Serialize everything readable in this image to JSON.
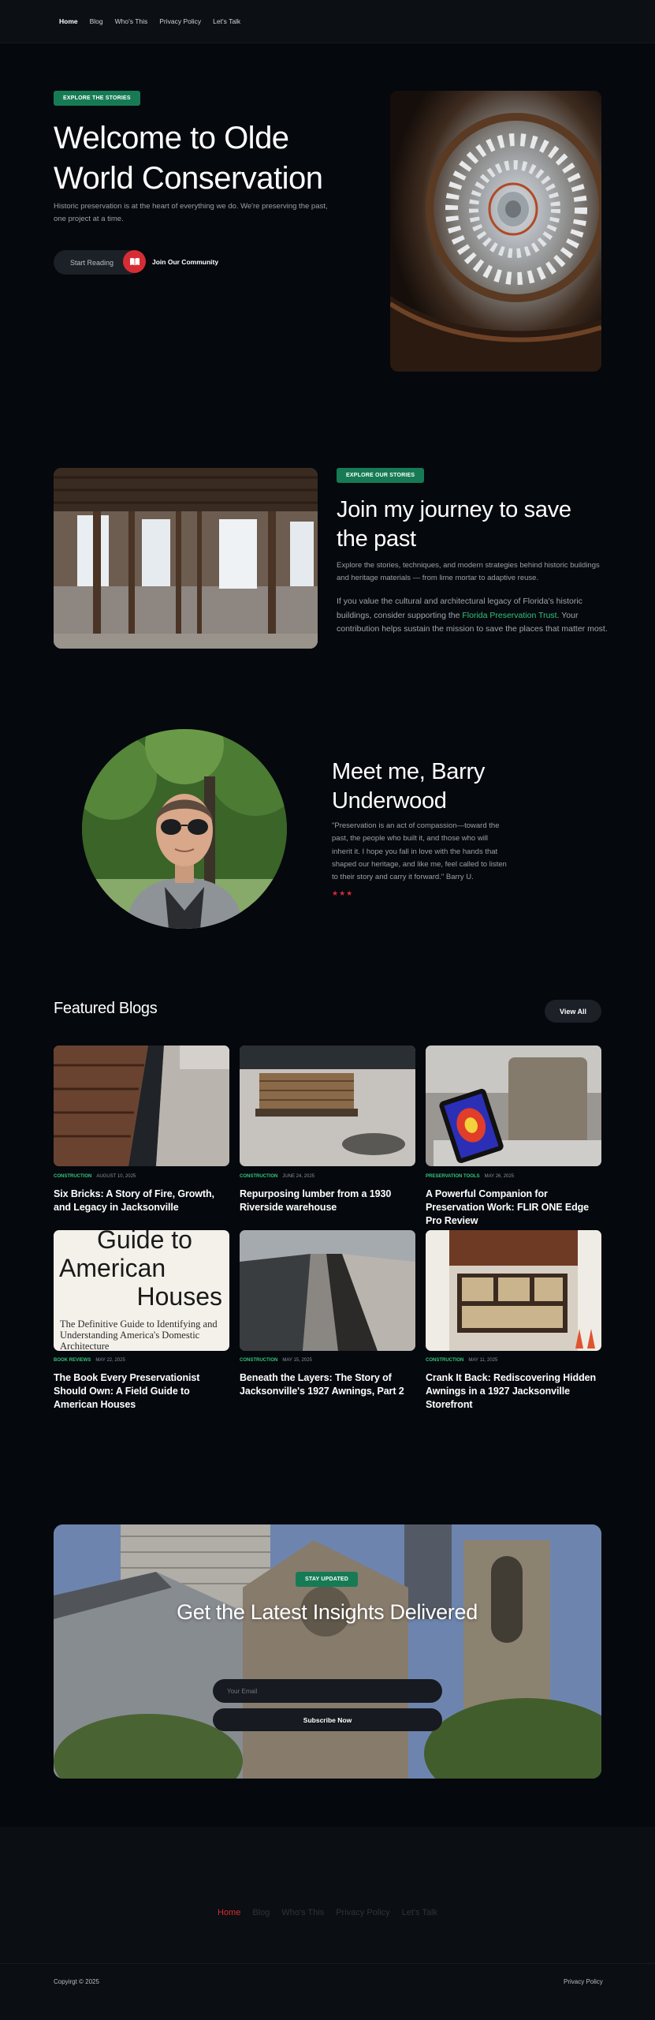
{
  "nav": {
    "items": [
      {
        "label": "Home",
        "active": true
      },
      {
        "label": "Blog"
      },
      {
        "label": "Who's This"
      },
      {
        "label": "Privacy Policy"
      },
      {
        "label": "Let's Talk"
      }
    ]
  },
  "hero": {
    "badge": "EXPLORE THE STORIES",
    "title": "Welcome to Olde World Conservation",
    "subtitle": "Historic preservation is at the heart of everything we do. We're preserving the past, one project at a time.",
    "start_reading": "Start Reading",
    "community_label": "Join Our Community",
    "icon": "book-icon"
  },
  "join": {
    "badge": "EXPLORE OUR STORIES",
    "title": "Join my journey to save the past",
    "intro": "Explore the stories, techniques, and modern strategies behind historic buildings and heritage materials — from lime mortar to adaptive reuse.",
    "body_before": "If you value the cultural and architectural legacy of Florida's historic buildings, consider supporting the ",
    "link_label": "Florida Preservation Trust",
    "body_after": ". Your contribution helps sustain the mission to save the places that matter most."
  },
  "meet": {
    "title": "Meet me, Barry Underwood",
    "quote": "\"Preservation is an act of compassion—toward the past, the people who built it, and those who will inherit it. I hope you fall in love with the hands that shaped our heritage, and like me, feel called to listen to their story and carry it forward.\" Barry U.",
    "stars": "★★★"
  },
  "featured": {
    "title": "Featured Blogs",
    "view_all": "View All",
    "posts": [
      {
        "category": "CONSTRUCTION",
        "date": "AUGUST 10, 2025",
        "title": "Six Bricks: A Story of Fire, Growth, and Legacy in Jacksonville"
      },
      {
        "category": "CONSTRUCTION",
        "date": "JUNE 24, 2025",
        "title": "Repurposing lumber from a 1930 Riverside warehouse"
      },
      {
        "category": "PRESERVATION TOOLS",
        "date": "MAY 26, 2025",
        "title": "A Powerful Companion for Preservation Work: FLIR ONE Edge Pro Review"
      },
      {
        "category": "BOOK REVIEWS",
        "date": "MAY 22, 2025",
        "title": "The Book Every Preservationist Should Own: A Field Guide to American Houses"
      },
      {
        "category": "CONSTRUCTION",
        "date": "MAY 15, 2025",
        "title": "Beneath the Layers: The Story of Jacksonville's 1927 Awnings, Part 2"
      },
      {
        "category": "CONSTRUCTION",
        "date": "MAY 11, 2025",
        "title": "Crank It Back: Rediscovering Hidden Awnings in a 1927 Jacksonville Storefront"
      }
    ],
    "book_cover": {
      "line1": "Guide to",
      "line2": "American",
      "line3": "Houses",
      "subtitle": "The Definitive Guide to Identifying and Understanding America's Domestic Architecture"
    }
  },
  "newsletter": {
    "badge": "STAY UPDATED",
    "title": "Get the Latest Insights Delivered",
    "email_placeholder": "Your Email",
    "subscribe_label": "Subscribe Now"
  },
  "footer": {
    "links": [
      {
        "label": "Home",
        "active": true
      },
      {
        "label": "Blog"
      },
      {
        "label": "Who's This"
      },
      {
        "label": "Privacy Policy"
      },
      {
        "label": "Let's Talk"
      }
    ],
    "copyright": "Copyirgt © 2025",
    "privacy": "Privacy Policy"
  },
  "colors": {
    "accent_green": "#167b55",
    "accent_red": "#d62d35",
    "link_green": "#33c47b"
  }
}
